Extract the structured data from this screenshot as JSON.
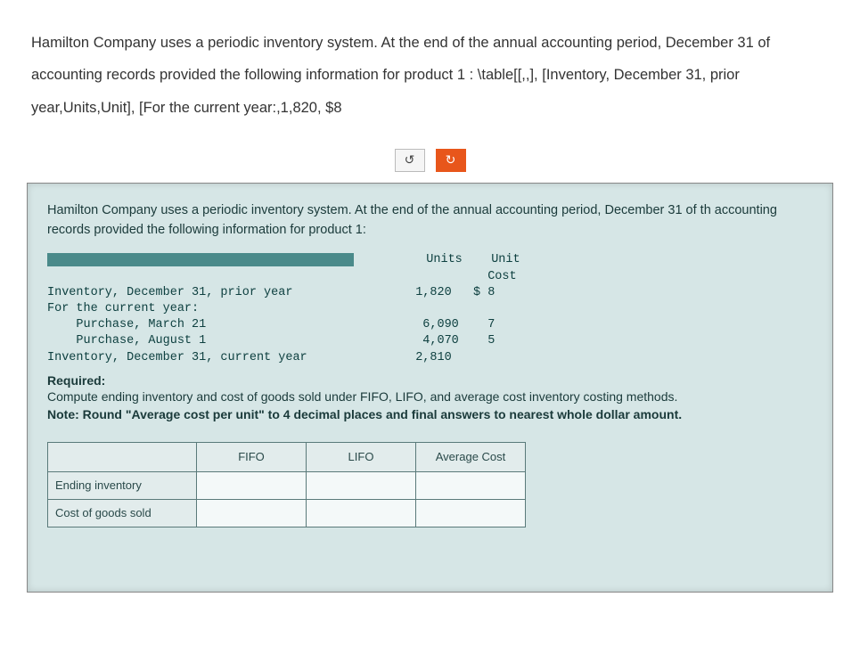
{
  "question": "Hamilton Company uses a periodic inventory system. At the end of the annual accounting period, December 31 of accounting records provided the following information for product 1 : \\table[[,,], [Inventory, December 31, prior year,Units,Unit], [For the current year:,1,820, $8",
  "toolbar": {
    "reset": "↺",
    "retry": "↻"
  },
  "panel": {
    "intro": "Hamilton Company uses a periodic inventory system. At the end of the annual accounting period, December 31 of th accounting records provided the following information for product 1:",
    "header": {
      "units": "Units",
      "unitcost1": "Unit",
      "unitcost2": "Cost"
    },
    "rows": {
      "r1": {
        "label": "Inventory, December 31, prior year",
        "units": "1,820",
        "cost": "$ 8"
      },
      "r2": {
        "label": "For the current year:"
      },
      "r3": {
        "label": "    Purchase, March 21",
        "units": "6,090",
        "cost": "7"
      },
      "r4": {
        "label": "    Purchase, August 1",
        "units": "4,070",
        "cost": "5"
      },
      "r5": {
        "label": "Inventory, December 31, current year",
        "units": "2,810"
      }
    },
    "required_label": "Required:",
    "instruct1": "Compute ending inventory and cost of goods sold under FIFO, LIFO, and average cost inventory costing methods.",
    "instruct2": "Note: Round \"Average cost per unit\" to 4 decimal places and final answers to nearest whole dollar amount.",
    "table": {
      "cols": {
        "fifo": "FIFO",
        "lifo": "LIFO",
        "avg": "Average Cost"
      },
      "rows": {
        "ei": "Ending inventory",
        "cogs": "Cost of goods sold"
      }
    }
  }
}
